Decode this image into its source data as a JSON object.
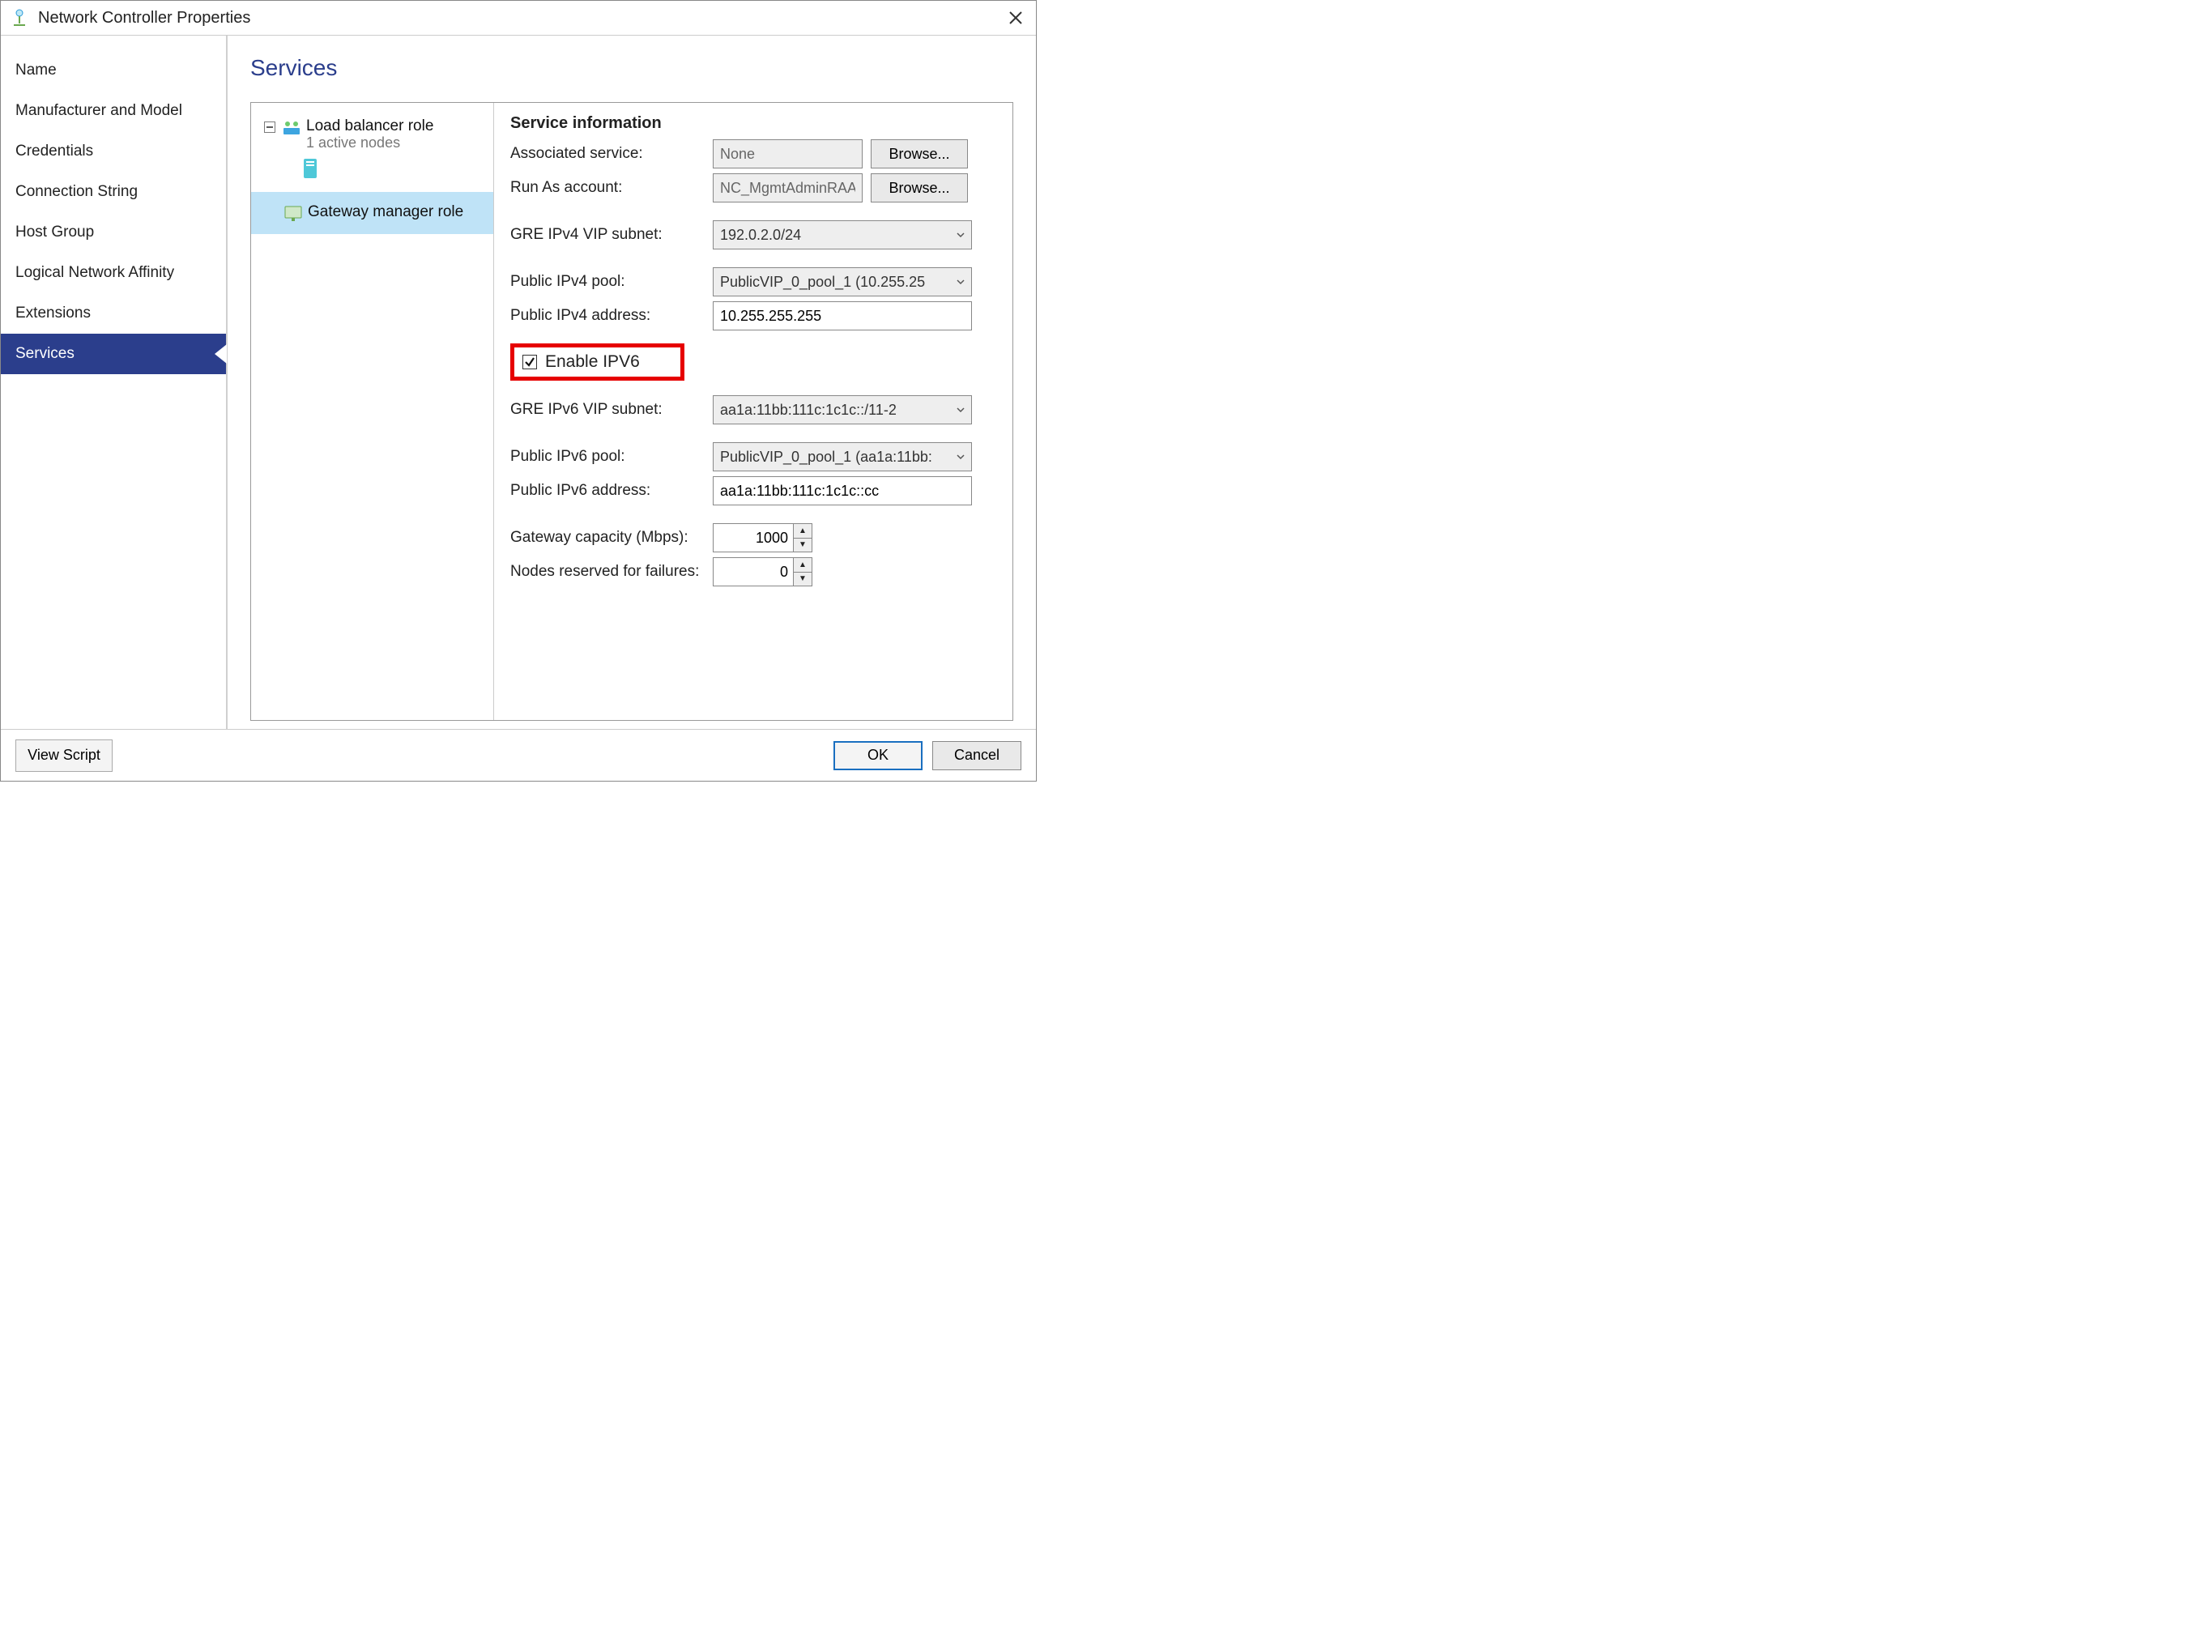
{
  "window": {
    "title": "Network Controller Properties"
  },
  "sidebar": {
    "items": [
      {
        "label": "Name"
      },
      {
        "label": "Manufacturer and Model"
      },
      {
        "label": "Credentials"
      },
      {
        "label": "Connection String"
      },
      {
        "label": "Host Group"
      },
      {
        "label": "Logical Network Affinity"
      },
      {
        "label": "Extensions"
      },
      {
        "label": "Services"
      }
    ]
  },
  "page": {
    "heading": "Services"
  },
  "tree": {
    "root": {
      "label": "Load balancer role",
      "sub": "1 active nodes"
    },
    "child": {
      "label": "Gateway manager role"
    }
  },
  "detail": {
    "section": "Service information",
    "assoc_label": "Associated service:",
    "assoc_value": "None",
    "runas_label": "Run As account:",
    "runas_value": "NC_MgmtAdminRAA",
    "browse": "Browse...",
    "gre4_label": "GRE IPv4 VIP subnet:",
    "gre4_value": "192.0.2.0/24",
    "pub4pool_label": "Public IPv4 pool:",
    "pub4pool_value": "PublicVIP_0_pool_1 (10.255.25",
    "pub4addr_label": "Public IPv4 address:",
    "pub4addr_value": "10.255.255.255",
    "enable_ipv6": "Enable IPV6",
    "gre6_label": "GRE IPv6 VIP subnet:",
    "gre6_value": "aa1a:11bb:111c:1c1c::/11-2",
    "pub6pool_label": "Public IPv6 pool:",
    "pub6pool_value": "PublicVIP_0_pool_1 (aa1a:11bb:",
    "pub6addr_label": "Public IPv6 address:",
    "pub6addr_value": "aa1a:11bb:111c:1c1c::cc",
    "capacity_label": "Gateway capacity (Mbps):",
    "capacity_value": "1000",
    "reserved_label": "Nodes reserved for failures:",
    "reserved_value": "0"
  },
  "footer": {
    "viewscript": "View Script",
    "ok": "OK",
    "cancel": "Cancel"
  }
}
